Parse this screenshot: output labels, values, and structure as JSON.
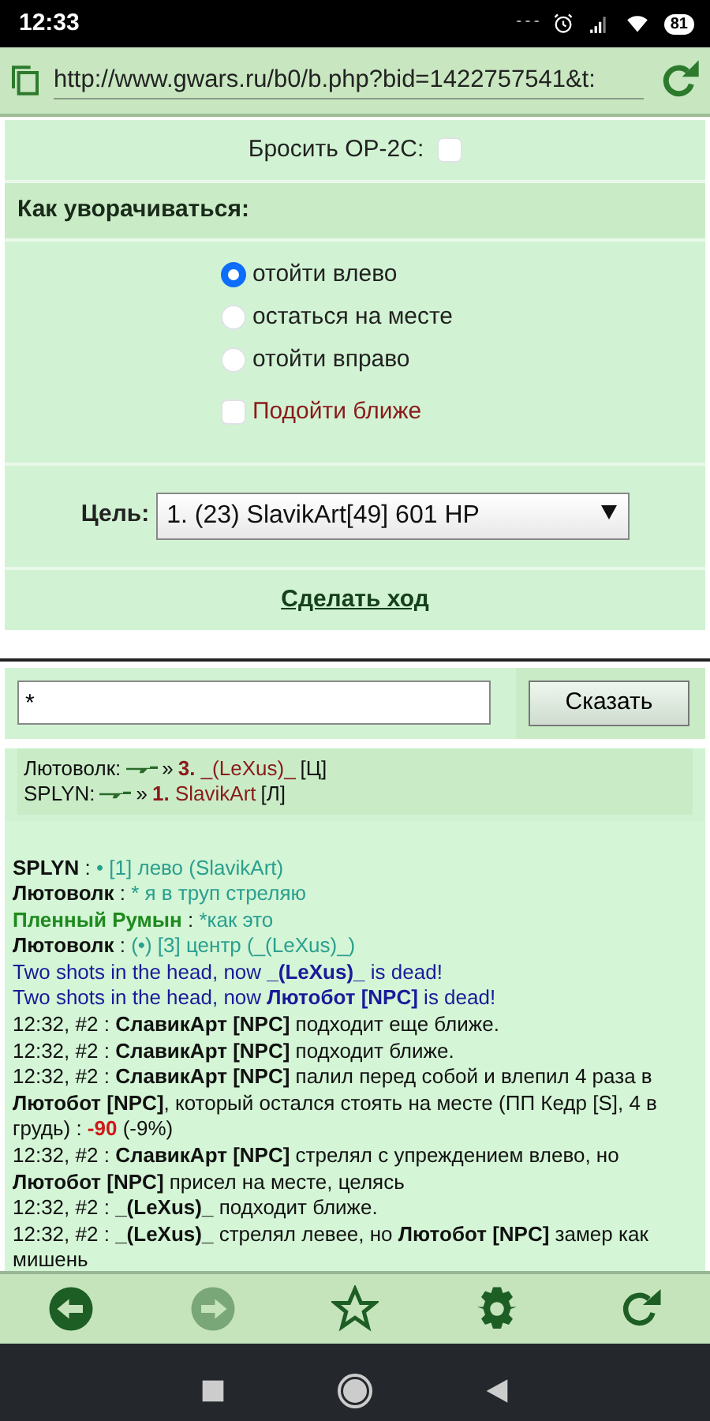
{
  "status_bar": {
    "time": "12:33",
    "battery": "81"
  },
  "address_bar": {
    "url": "http://www.gwars.ru/b0/b.php?bid=1422757541&t:"
  },
  "form": {
    "grenade": {
      "label": "Бросить ОР-2С:",
      "checked": false
    },
    "dodge_heading": "Как уворачиваться:",
    "dodge_options": [
      {
        "label": "отойти влево",
        "selected": true
      },
      {
        "label": "остаться на месте",
        "selected": false
      },
      {
        "label": "отойти вправо",
        "selected": false
      }
    ],
    "approach": {
      "label": "Подойти ближе",
      "checked": false
    },
    "target": {
      "label": "Цель:",
      "value": "1. (23) SlavikArt[49] 601 HP"
    },
    "submit": "Сделать ход"
  },
  "chat": {
    "input_value": "*",
    "say_button": "Сказать"
  },
  "orders": [
    {
      "who": "Лютоволк:",
      "arrow": "»",
      "number": "3.",
      "target": "_(LeXus)_",
      "side": "[Ц]"
    },
    {
      "who": "SPLYN:",
      "arrow": "»",
      "number": "1.",
      "target": "SlavikArt",
      "side": "[Л]"
    }
  ],
  "log": [
    {
      "kind": "chat",
      "author": "SPLYN",
      "sep": " : ",
      "text": "• [1] лево (SlavikArt)",
      "color": "#111111"
    },
    {
      "kind": "chat",
      "author": "Лютоволк",
      "sep": " : ",
      "text": "* я в труп стреляю",
      "color": "#111111"
    },
    {
      "kind": "chat",
      "author": "Пленный Румын",
      "sep": " : ",
      "text": "*как это",
      "color": "#1e8a1e"
    },
    {
      "kind": "chat",
      "author": "Лютоволк",
      "sep": " : ",
      "text": "(•) [3] центр (_(LeXus)_)",
      "color": "#111111"
    },
    {
      "kind": "death",
      "text": "Two shots in the head, now **_(LeXus)_** is dead!"
    },
    {
      "kind": "death",
      "text": "Two shots in the head, now **Лютобот [NPC]** is dead!"
    },
    {
      "kind": "event",
      "segments": [
        {
          "text": "12:32, #2 : ",
          "kind": "plain"
        },
        {
          "text": "СлавикАрт [NPC]",
          "kind": "bold"
        },
        {
          "text": " подходит еще ближе.",
          "kind": "plain"
        }
      ]
    },
    {
      "kind": "event",
      "segments": [
        {
          "text": "12:32, #2 : ",
          "kind": "plain"
        },
        {
          "text": "СлавикАрт [NPC]",
          "kind": "bold"
        },
        {
          "text": " подходит ближе.",
          "kind": "plain"
        }
      ]
    },
    {
      "kind": "event",
      "segments": [
        {
          "text": "12:32, #2 : ",
          "kind": "plain"
        },
        {
          "text": "СлавикАрт [NPC]",
          "kind": "bold"
        },
        {
          "text": " палил перед собой и влепил 4 раза в ",
          "kind": "plain"
        },
        {
          "text": "Лютобот [NPC]",
          "kind": "bold"
        },
        {
          "text": ", который остался стоять на месте (ПП Кедр [S], 4 в грудь) : ",
          "kind": "plain"
        },
        {
          "text": "-90",
          "kind": "damage"
        },
        {
          "text": " (-9%)",
          "kind": "plain"
        }
      ]
    },
    {
      "kind": "event",
      "segments": [
        {
          "text": "12:32, #2 : ",
          "kind": "plain"
        },
        {
          "text": "СлавикАрт [NPC]",
          "kind": "bold"
        },
        {
          "text": " стрелял с упреждением влево, но ",
          "kind": "plain"
        },
        {
          "text": "Лютобот [NPC]",
          "kind": "bold"
        },
        {
          "text": " присел на месте, целясь",
          "kind": "plain"
        }
      ]
    },
    {
      "kind": "event",
      "segments": [
        {
          "text": "12:32, #2 : ",
          "kind": "plain"
        },
        {
          "text": "_(LeXus)_",
          "kind": "bold"
        },
        {
          "text": " подходит ближе.",
          "kind": "plain"
        }
      ]
    },
    {
      "kind": "event",
      "segments": [
        {
          "text": "12:32, #2 : ",
          "kind": "plain"
        },
        {
          "text": "_(LeXus)_",
          "kind": "bold"
        },
        {
          "text": " стрелял левее, но ",
          "kind": "plain"
        },
        {
          "text": "Лютобот [NPC]",
          "kind": "bold"
        },
        {
          "text": " замер как мишень",
          "kind": "plain"
        }
      ]
    }
  ],
  "toolbar": [
    {
      "kind": "back",
      "disabled": false
    },
    {
      "kind": "forward",
      "disabled": true
    },
    {
      "kind": "star",
      "disabled": false
    },
    {
      "kind": "gear",
      "disabled": false
    },
    {
      "kind": "reload",
      "disabled": false
    }
  ]
}
